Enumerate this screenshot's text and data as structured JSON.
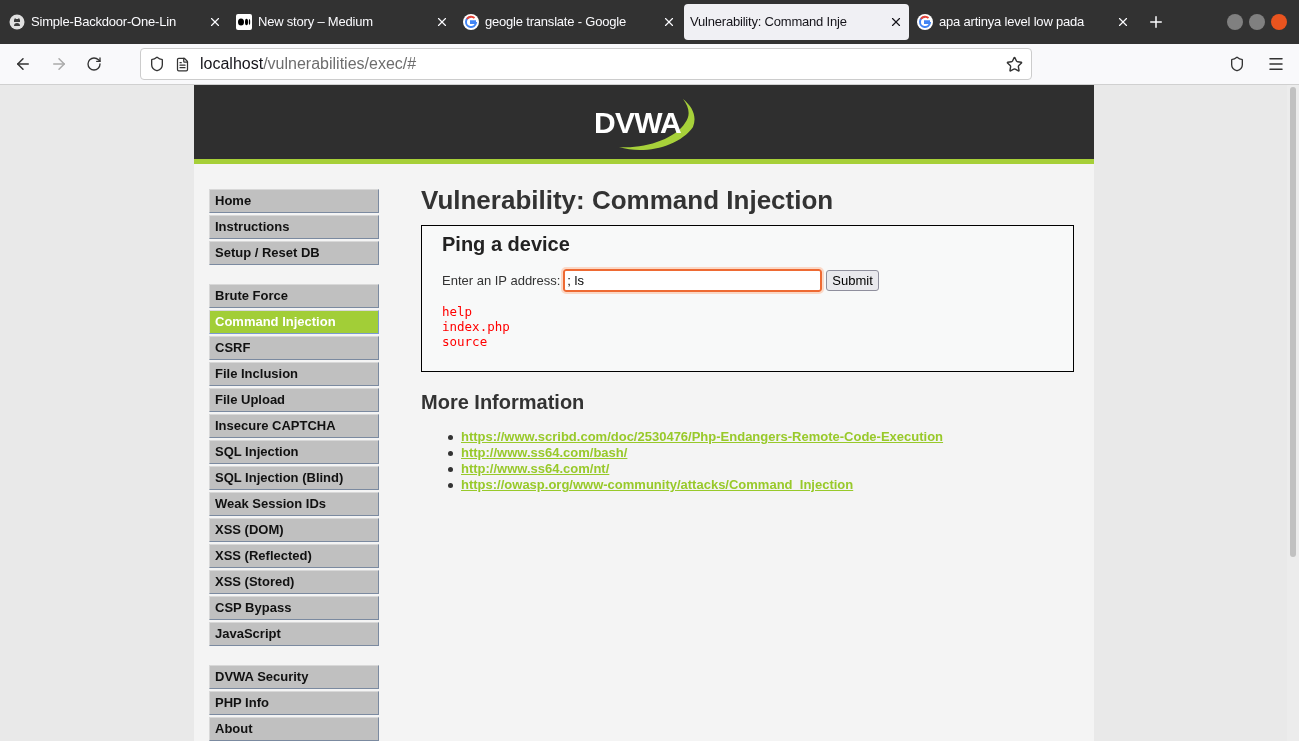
{
  "browser": {
    "tabs": [
      {
        "title": "Simple-Backdoor-One-Lin",
        "selected": false
      },
      {
        "title": "New story – Medium",
        "selected": false
      },
      {
        "title": "geogle translate - Google",
        "selected": false
      },
      {
        "title": "Vulnerability: Command Inje",
        "selected": true
      },
      {
        "title": "apa artinya level low pada",
        "selected": false
      }
    ],
    "address": {
      "host": "localhost",
      "path": "/vulnerabilities/exec/#"
    }
  },
  "header": {
    "logo": "DVWA"
  },
  "menu": [
    [
      {
        "label": "Home",
        "selected": false
      },
      {
        "label": "Instructions",
        "selected": false
      },
      {
        "label": "Setup / Reset DB",
        "selected": false
      }
    ],
    [
      {
        "label": "Brute Force",
        "selected": false
      },
      {
        "label": "Command Injection",
        "selected": true
      },
      {
        "label": "CSRF",
        "selected": false
      },
      {
        "label": "File Inclusion",
        "selected": false
      },
      {
        "label": "File Upload",
        "selected": false
      },
      {
        "label": "Insecure CAPTCHA",
        "selected": false
      },
      {
        "label": "SQL Injection",
        "selected": false
      },
      {
        "label": "SQL Injection (Blind)",
        "selected": false
      },
      {
        "label": "Weak Session IDs",
        "selected": false
      },
      {
        "label": "XSS (DOM)",
        "selected": false
      },
      {
        "label": "XSS (Reflected)",
        "selected": false
      },
      {
        "label": "XSS (Stored)",
        "selected": false
      },
      {
        "label": "CSP Bypass",
        "selected": false
      },
      {
        "label": "JavaScript",
        "selected": false
      }
    ],
    [
      {
        "label": "DVWA Security",
        "selected": false
      },
      {
        "label": "PHP Info",
        "selected": false
      },
      {
        "label": "About",
        "selected": false
      }
    ]
  ],
  "main": {
    "title": "Vulnerability: Command Injection",
    "form": {
      "heading": "Ping a device",
      "label": "Enter an IP address:",
      "value": "; ls",
      "button": "Submit",
      "output": [
        "help",
        "index.php",
        "source"
      ]
    },
    "more_heading": "More Information",
    "links": [
      "https://www.scribd.com/doc/2530476/Php-Endangers-Remote-Code-Execution",
      "http://www.ss64.com/bash/",
      "http://www.ss64.com/nt/",
      "https://owasp.org/www-community/attacks/Command_Injection"
    ]
  }
}
